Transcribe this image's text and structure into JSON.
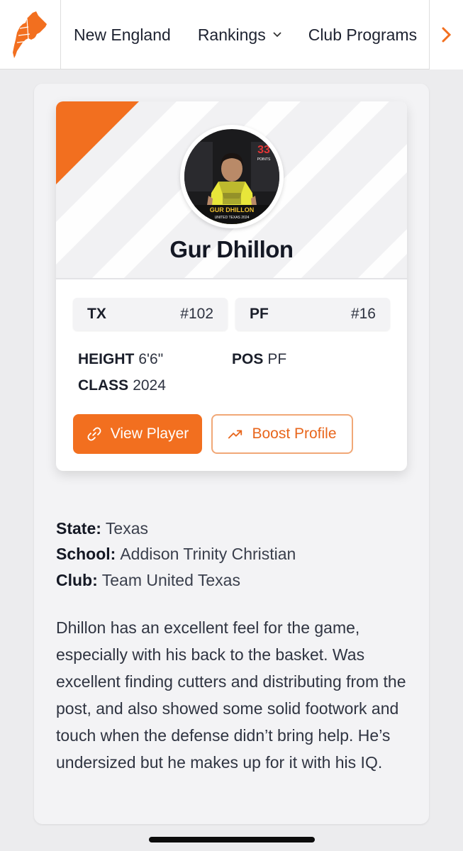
{
  "nav": {
    "links": [
      "New England",
      "Rankings",
      "Club Programs"
    ],
    "rankings_chevron": "chevron-down-icon",
    "next_icon": "chevron-right-icon"
  },
  "player": {
    "name": "Gur Dhillon",
    "photo_caption": "GUR DHILLON",
    "photo_subcaption": "UNITED TEXAS 2024",
    "state_rank_label": "TX",
    "state_rank_value": "#102",
    "pos_rank_label": "PF",
    "pos_rank_value": "#16",
    "height_label": "HEIGHT",
    "height_value": "6'6\"",
    "pos_label": "POS",
    "pos_value": "PF",
    "class_label": "CLASS",
    "class_value": "2024"
  },
  "buttons": {
    "view_player": "View Player",
    "boost_profile": "Boost Profile"
  },
  "details": {
    "state_label": "State:",
    "state_value": "Texas",
    "school_label": "School:",
    "school_value": "Addison Trinity Christian",
    "club_label": "Club:",
    "club_value": "Team United Texas"
  },
  "description": "Dhillon has an excellent feel for the game, especially with his back to the basket. Was excellent finding cutters and distributing from the post, and also showed some solid footwork and touch when the defense didn’t bring help. He’s undersized but he makes up for it with his IQ.",
  "colors": {
    "accent": "#f26f1f",
    "text": "#141824"
  }
}
